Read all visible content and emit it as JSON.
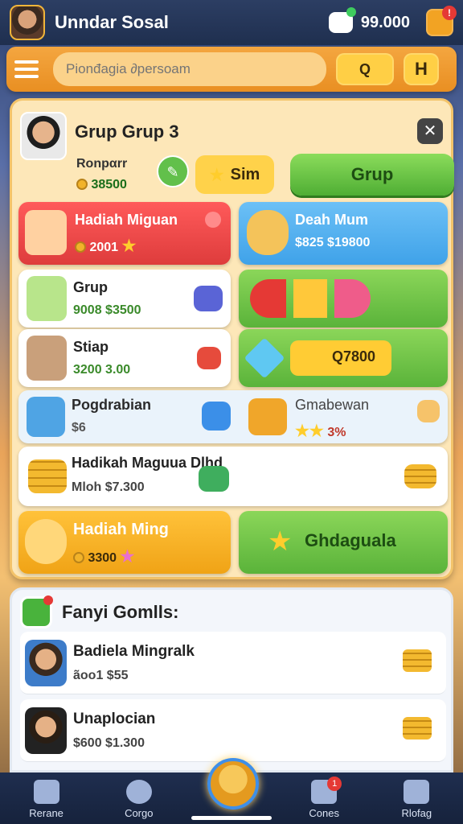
{
  "top": {
    "title": "Unndar Sosal",
    "coins": "99.000"
  },
  "search": {
    "placeholder": "Pionđagia ∂persoam",
    "button": "Q",
    "button2": "H"
  },
  "group": {
    "title": "Grup Grup 3",
    "subtitle": "Ronpαrr",
    "score": "38500",
    "sim_label": "Sim",
    "grup_label": "Grup"
  },
  "cards": {
    "red": {
      "title": "Hadiah Miguan",
      "meta": "2001"
    },
    "blue": {
      "title": "Deah Mum",
      "meta": "$825 $19800"
    },
    "grup_row": {
      "title": "Grup",
      "meta": "9008 $3500"
    },
    "stiap_row": {
      "title": "Stiap",
      "meta": "3200 3.00"
    },
    "green_row2": {
      "value": "Q7800"
    },
    "pogd_row": {
      "title": "Pogdrabian",
      "meta": "$6"
    },
    "gmab_row": {
      "title": "Gmabewan",
      "meta": "3%"
    },
    "hadikah_row": {
      "title": "Hadikah Maguua Dlhd",
      "meta": "Mlοh $7.300"
    },
    "orange": {
      "title": "Hadiah Ming",
      "meta": "3300"
    },
    "green_big": {
      "title": "Ghdaguala"
    }
  },
  "friends": {
    "header": "Fanyi Gomlls:",
    "rows": [
      {
        "name": "Badiela Mingralk",
        "meta": "ãoo1 $55"
      },
      {
        "name": "Unaplocian",
        "meta": "$600 $1.300"
      }
    ]
  },
  "nav": [
    {
      "label": "Rerane"
    },
    {
      "label": "Corgo"
    },
    {
      "label": ""
    },
    {
      "label": "Cones",
      "badge": "1"
    },
    {
      "label": "Rlofag"
    }
  ]
}
